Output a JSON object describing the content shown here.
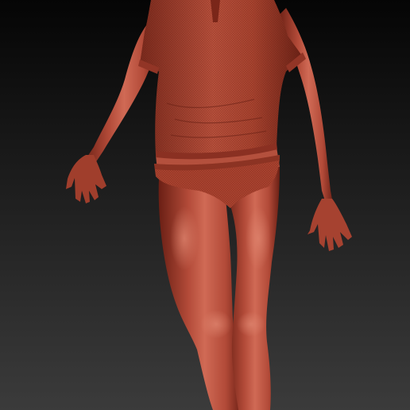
{
  "viewport": {
    "background_top": "#050505",
    "background_bottom": "#3b3b3b",
    "material_base": "#b24a38",
    "material_shadow": "#6a1f14",
    "material_highlight": "#e08670"
  }
}
